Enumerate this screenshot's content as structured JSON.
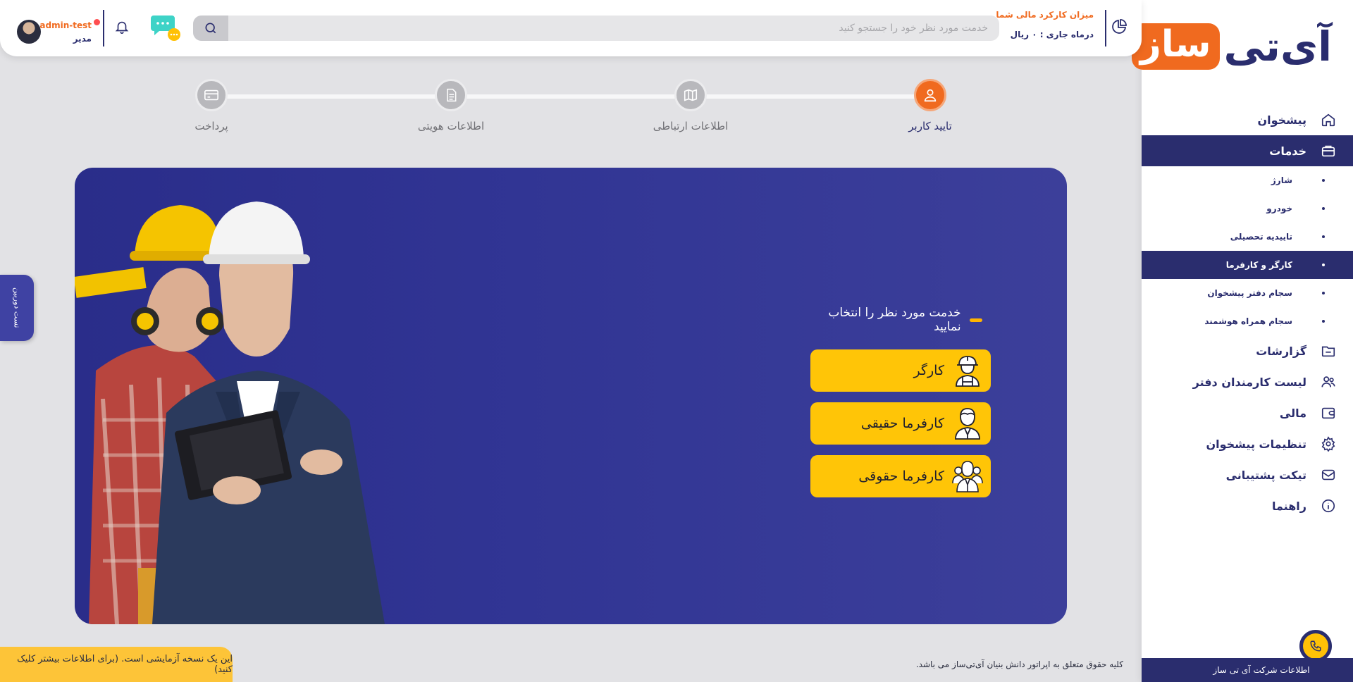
{
  "brand": {
    "logo_part1": "آی‌تی",
    "logo_part2": "ساز",
    "brand_blue": "#2a2d6e",
    "brand_orange": "#f06a1f"
  },
  "header": {
    "search_placeholder": "خدمت مورد نظر خود را جستجو کنید",
    "finance_title": "میزان کارکرد مالی شما",
    "finance_value": "درماه جاری : ۰ ریال",
    "user_name": "admin-test",
    "user_role": "مدیر"
  },
  "sidebar": {
    "items": [
      {
        "label": "پیشخوان",
        "icon": "home-icon"
      },
      {
        "label": "خدمات",
        "icon": "briefcase-icon",
        "active": true
      },
      {
        "label": "گزارشات",
        "icon": "folder-icon"
      },
      {
        "label": "لیست کارمندان دفتر",
        "icon": "users-icon"
      },
      {
        "label": "مالی",
        "icon": "wallet-icon"
      },
      {
        "label": "تنظیمات پیشخوان",
        "icon": "gear-icon"
      },
      {
        "label": "تیکت پشتیبانی",
        "icon": "mail-icon"
      },
      {
        "label": "راهنما",
        "icon": "info-icon"
      }
    ],
    "subitems": [
      {
        "label": "شارژ"
      },
      {
        "label": "خودرو"
      },
      {
        "label": "تاییدیه تحصیلی"
      },
      {
        "label": "کارگر و کارفرما",
        "active": true
      },
      {
        "label": "سجام دفتر پیشخوان"
      },
      {
        "label": "سجام همراه هوشمند"
      }
    ],
    "company_info": "اطلاعات شرکت آی تی ساز"
  },
  "stepper": {
    "steps": [
      {
        "label": "تایید کاربر",
        "icon": "user-check-icon",
        "active": true
      },
      {
        "label": "اطلاعات ارتباطی",
        "icon": "map-icon"
      },
      {
        "label": "اطلاعات هویتی",
        "icon": "document-icon"
      },
      {
        "label": "پرداخت",
        "icon": "card-icon"
      }
    ]
  },
  "hero": {
    "title": "خدمت مورد نظر را انتخاب نمایید",
    "services": [
      {
        "label": "کارگر",
        "icon": "worker-icon"
      },
      {
        "label": "کارفرما حقیقی",
        "icon": "employer-icon"
      },
      {
        "label": "کارفرما حقوقی",
        "icon": "company-icon"
      }
    ],
    "accent": "#ffc507"
  },
  "side_tab": "تست دوربین",
  "trial_banner": "این یک نسخه آزمایشی است. (برای اطلاعات بیشتر کلیک کنید)",
  "footer": "کلیه حقوق متعلق به اپراتور دانش بنیان آی‌تی‌ساز می باشد."
}
